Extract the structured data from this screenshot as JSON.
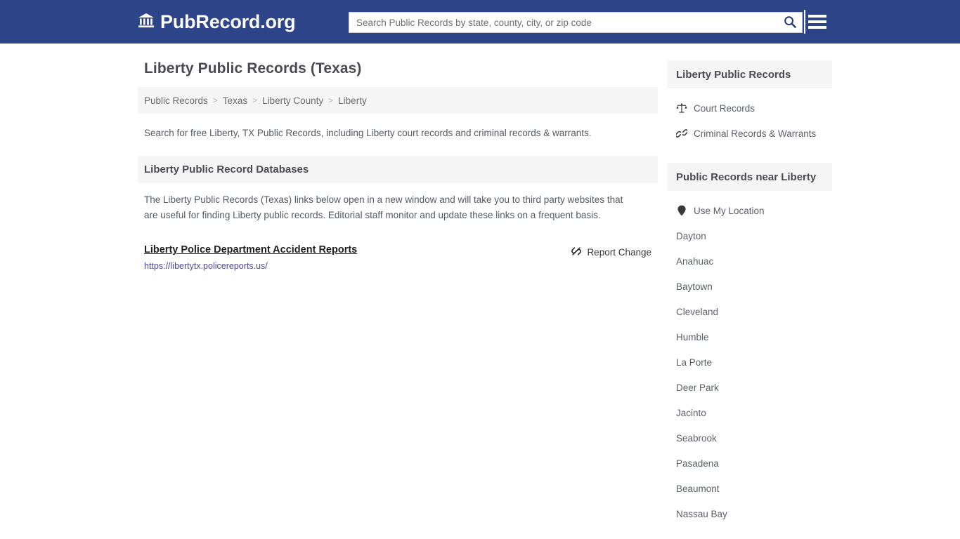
{
  "header": {
    "brand_name": "PubRecord.org",
    "brand_icon": "bank-building-icon",
    "search_placeholder": "Search Public Records by state, county, city, or zip code",
    "search_value": "",
    "search_icon": "search-icon",
    "menu_icon": "hamburger-menu-icon",
    "background_color": "#2e4489"
  },
  "main": {
    "title": "Liberty Public Records (Texas)",
    "breadcrumb": {
      "separator": ">",
      "items": [
        {
          "label": "Public Records"
        },
        {
          "label": "Texas"
        },
        {
          "label": "Liberty County"
        },
        {
          "label": "Liberty"
        }
      ]
    },
    "intro": "Search for free Liberty, TX Public Records, including Liberty court records and criminal records & warrants.",
    "section_heading": "Liberty Public Record Databases",
    "description": "The Liberty Public Records (Texas) links below open in a new window and will take you to third party websites that are useful for finding Liberty public records. Editorial staff monitor and update these links on a frequent basis.",
    "records": [
      {
        "title": "Liberty Police Department Accident Reports",
        "url": "https://libertytx.policereports.us/",
        "report_change_label": "Report Change",
        "report_change_icon": "broken-link-icon"
      }
    ]
  },
  "sidebar": {
    "records_section": {
      "heading": "Liberty Public Records",
      "items": [
        {
          "label": "Court Records",
          "icon": "scales-of-justice-icon"
        },
        {
          "label": "Criminal Records & Warrants",
          "icon": "chain-link-icon"
        }
      ]
    },
    "nearby_section": {
      "heading": "Public Records near Liberty",
      "use_my_location": {
        "label": "Use My Location",
        "icon": "map-pin-icon"
      },
      "cities": [
        {
          "label": "Dayton"
        },
        {
          "label": "Anahuac"
        },
        {
          "label": "Baytown"
        },
        {
          "label": "Cleveland"
        },
        {
          "label": "Humble"
        },
        {
          "label": "La Porte"
        },
        {
          "label": "Deer Park"
        },
        {
          "label": "Jacinto"
        },
        {
          "label": "Seabrook"
        },
        {
          "label": "Pasadena"
        },
        {
          "label": "Beaumont"
        },
        {
          "label": "Nassau Bay"
        }
      ]
    }
  }
}
